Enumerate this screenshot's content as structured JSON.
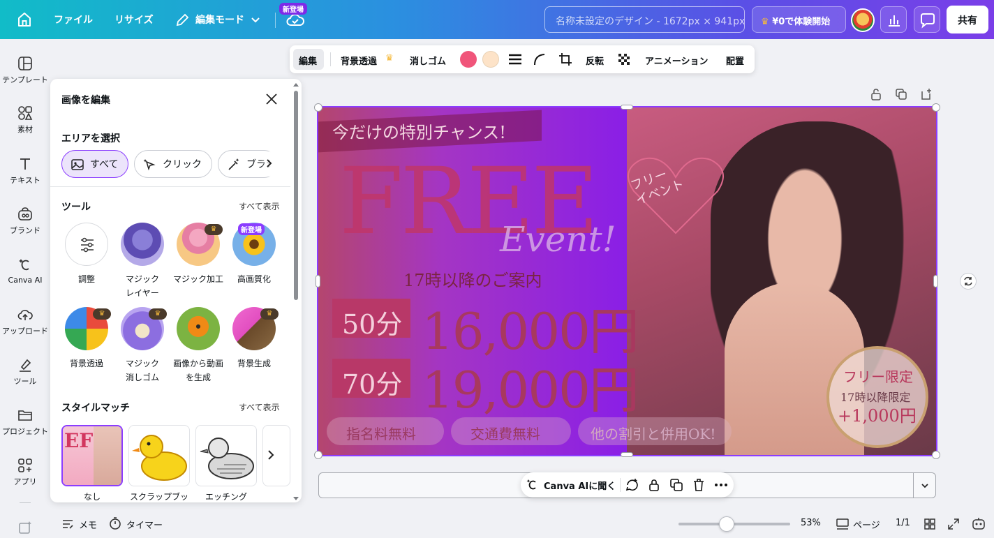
{
  "topbar": {
    "menu": [
      "ファイル",
      "リサイズ",
      "編集モード"
    ],
    "new_badge": "新登場",
    "design_title_placeholder": "名称未設定のデザイン - 1672px × 941px",
    "trial_button": "¥0で体験開始",
    "share_button": "共有"
  },
  "rail": {
    "items": [
      "テンプレート",
      "素材",
      "テキスト",
      "ブランド",
      "Canva AI",
      "アップロード",
      "ツール",
      "プロジェクト",
      "アプリ"
    ]
  },
  "panel": {
    "title": "画像を編集",
    "area_title": "エリアを選択",
    "area_chips": [
      "すべて",
      "クリック",
      "ブラシ"
    ],
    "tools_title": "ツール",
    "tools_link": "すべて表示",
    "tools": [
      {
        "label": "調整",
        "icon": "sliders-icon"
      },
      {
        "label": "マジック\nレイヤー",
        "icon": "magic-layer-icon"
      },
      {
        "label": "マジック加工",
        "icon": "magic-edit-icon",
        "premium": true
      },
      {
        "label": "高画質化",
        "icon": "upscale-icon",
        "badge": "新登場"
      },
      {
        "label": "背景透過",
        "icon": "bg-remove-icon",
        "premium": true
      },
      {
        "label": "マジック\n消しゴム",
        "icon": "magic-eraser-icon",
        "premium": true
      },
      {
        "label": "画像から動画\nを生成",
        "icon": "image-to-video-icon"
      },
      {
        "label": "背景生成",
        "icon": "bg-generate-icon",
        "premium": true
      }
    ],
    "style_title": "スタイルマッチ",
    "style_link": "すべて表示",
    "styles": [
      "なし",
      "スクラップブッ",
      "エッチング"
    ]
  },
  "context_toolbar": {
    "edit": "編集",
    "bg_remove": "背景透過",
    "eraser": "消しゴム",
    "flip": "反転",
    "animate": "アニメーション",
    "position": "配置",
    "colors": [
      "#f0557a",
      "#fde3c8"
    ]
  },
  "canvas": {
    "banner": "今だけの特別チャンス!",
    "free": "FREE",
    "event": "Event!",
    "subtitle": "17時以降のご案内",
    "heart_text": "フリー\nイベント",
    "rows": [
      {
        "minutes": "50分",
        "price": "16,000円"
      },
      {
        "minutes": "70分",
        "price": "19,000円"
      }
    ],
    "pills": [
      "指名料無料",
      "交通費無料",
      "他の割引と併用OK!"
    ],
    "badge_title": "フリー限定",
    "badge_sub": "17時以降限定",
    "badge_price": "+1,000円"
  },
  "ai_pill": {
    "label": "Canva AIに聞く"
  },
  "bottombar": {
    "notes": "メモ",
    "timer": "タイマー",
    "zoom": "53%",
    "zoom_fraction": 0.53,
    "pages_label": "ページ",
    "page_count": "1/1"
  },
  "colors": {
    "accent": "#8b3dff",
    "premium": "#f5b93b"
  }
}
